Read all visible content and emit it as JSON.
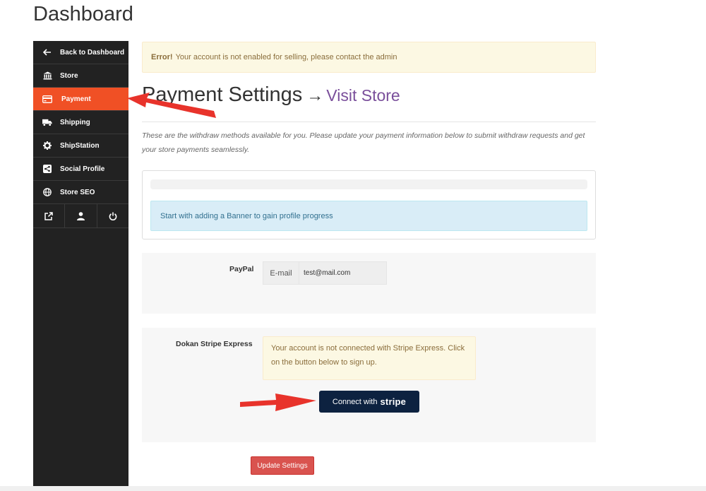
{
  "page": {
    "title": "Dashboard"
  },
  "sidebar": {
    "items": [
      {
        "label": "Back to Dashboard",
        "icon": "arrow-left-icon"
      },
      {
        "label": "Store",
        "icon": "bank-icon"
      },
      {
        "label": "Payment",
        "icon": "credit-card-icon"
      },
      {
        "label": "Shipping",
        "icon": "truck-icon"
      },
      {
        "label": "ShipStation",
        "icon": "gear-icon"
      },
      {
        "label": "Social Profile",
        "icon": "share-icon"
      },
      {
        "label": "Store SEO",
        "icon": "globe-icon"
      }
    ],
    "bottom_icons": [
      "external-link-icon",
      "user-icon",
      "power-icon"
    ],
    "active": "Payment",
    "accent": "#f05025"
  },
  "alert": {
    "strong": "Error!",
    "text": "Your account is not enabled for selling, please contact the admin"
  },
  "heading": {
    "title": "Payment Settings",
    "arrow": "→",
    "link": "Visit Store"
  },
  "intro": "These are the withdraw methods available for you. Please update your payment information below to submit withdraw requests and get your store payments seamlessly.",
  "progress": {
    "value": 0,
    "message": "Start with adding a Banner to gain profile progress"
  },
  "paypal": {
    "label": "PayPal",
    "addon": "E-mail",
    "email": "test@mail.com"
  },
  "stripe": {
    "label": "Dokan Stripe Express",
    "warning": "Your account is not connected with Stripe Express. Click on the button below to sign up.",
    "button_prefix": "Connect with",
    "button_brand": "stripe"
  },
  "actions": {
    "update": "Update Settings"
  },
  "colors": {
    "annotation_arrow": "#e8332b",
    "stripe_button": "#0d2240",
    "update_button": "#d9534f"
  }
}
